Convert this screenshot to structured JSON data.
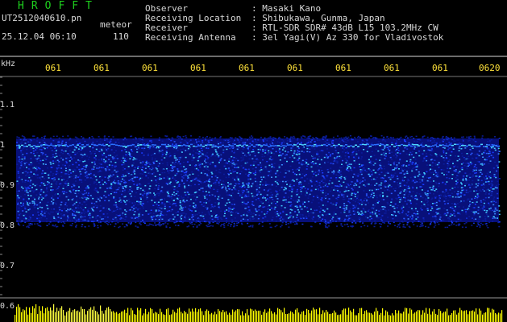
{
  "app_title": "HROFFT",
  "file_name": "UT2512040610.pn",
  "tag": "meteor",
  "date_time": "25.12.04 06:10",
  "count": "110",
  "info": [
    {
      "label": "Observer",
      "value": ": Masaki Kano"
    },
    {
      "label": "Receiving Location",
      "value": ": Shibukawa, Gunma, Japan"
    },
    {
      "label": "Receiver",
      "value": ": RTL-SDR SDR# 43dB L15 103.2MHz CW"
    },
    {
      "label": "Receiving Antenna",
      "value": ": 3el Yagi(V) Az 330 for Vladivostok"
    }
  ],
  "y_unit": "kHz",
  "time_ticks": [
    "061",
    "061",
    "061",
    "061",
    "061",
    "061",
    "061",
    "061",
    "061",
    "0620"
  ],
  "freq_ticks": [
    "1.1",
    "1",
    "0.9",
    "0.8",
    "0.7",
    "0.6"
  ],
  "colors": {
    "signal_band": "#1a3cff",
    "hot_pixel": "#40e0ff",
    "bottom_bar": "#ffff00",
    "title": "#1ed01e",
    "ticks": "#ffe23a"
  }
}
